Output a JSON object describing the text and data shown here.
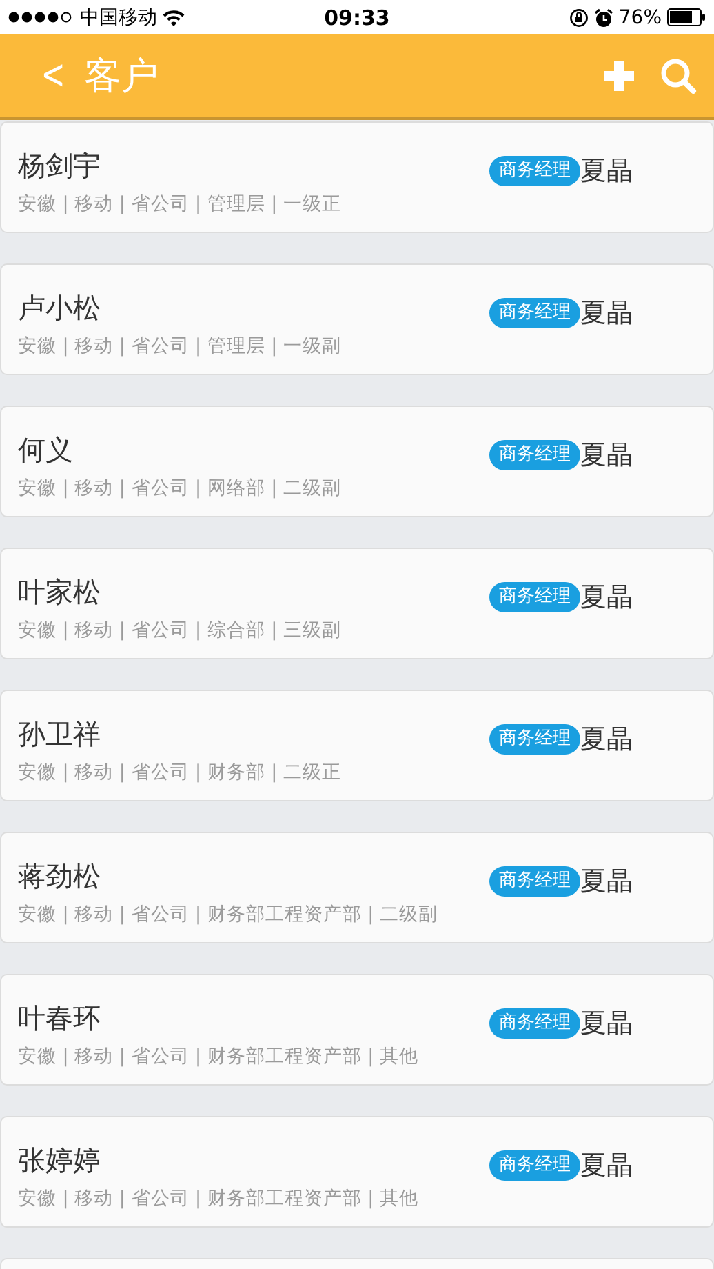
{
  "status_bar": {
    "carrier": "中国移动",
    "time": "09:33",
    "battery": "76%"
  },
  "header": {
    "back": "<",
    "title": "客户"
  },
  "customers": [
    {
      "name": "杨剑宇",
      "details": "安徽 | 移动 | 省公司 | 管理层 | 一级正",
      "role": "商务经理",
      "manager": "夏晶"
    },
    {
      "name": "卢小松",
      "details": "安徽 | 移动 | 省公司 | 管理层 | 一级副",
      "role": "商务经理",
      "manager": "夏晶"
    },
    {
      "name": "何义",
      "details": "安徽 | 移动 | 省公司 | 网络部 | 二级副",
      "role": "商务经理",
      "manager": "夏晶"
    },
    {
      "name": "叶家松",
      "details": "安徽 | 移动 | 省公司 | 综合部 | 三级副",
      "role": "商务经理",
      "manager": "夏晶"
    },
    {
      "name": "孙卫祥",
      "details": "安徽 | 移动 | 省公司 | 财务部 | 二级正",
      "role": "商务经理",
      "manager": "夏晶"
    },
    {
      "name": "蒋劲松",
      "details": "安徽 | 移动 | 省公司 | 财务部工程资产部 | 二级副",
      "role": "商务经理",
      "manager": "夏晶"
    },
    {
      "name": "叶春环",
      "details": "安徽 | 移动 | 省公司 | 财务部工程资产部 | 其他",
      "role": "商务经理",
      "manager": "夏晶"
    },
    {
      "name": "张婷婷",
      "details": "安徽 | 移动 | 省公司 | 财务部工程资产部 | 其他",
      "role": "商务经理",
      "manager": "夏晶"
    }
  ]
}
